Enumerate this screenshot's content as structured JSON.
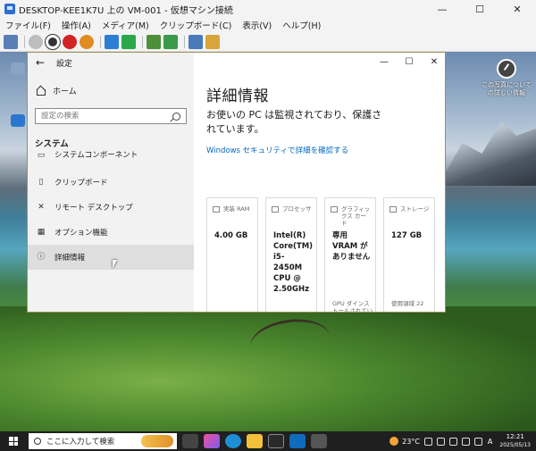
{
  "host": {
    "title": "DESKTOP-KEE1K7U 上の VM-001 - 仮想マシン接続",
    "controls": {
      "minimize": "—",
      "maximize": "☐",
      "close": "✕"
    },
    "menu": [
      "ファイル(F)",
      "操作(A)",
      "メディア(M)",
      "クリップボード(C)",
      "表示(V)",
      "ヘルプ(H)"
    ]
  },
  "desktop": {
    "shortcut_label": "この写真についての詳しい情報"
  },
  "settings": {
    "window_title": "設定",
    "back_glyph": "←",
    "controls": {
      "minimize": "—",
      "maximize": "☐",
      "close": "✕"
    },
    "home_label": "ホーム",
    "search_placeholder": "設定の検索",
    "section_heading": "システム",
    "nav_items": [
      {
        "label": "システムコンポーネント",
        "icon": "component-icon"
      },
      {
        "label": "クリップボード",
        "icon": "clipboard-icon"
      },
      {
        "label": "リモート デスクトップ",
        "icon": "remote-desktop-icon"
      },
      {
        "label": "オプション機能",
        "icon": "optional-features-icon"
      },
      {
        "label": "詳細情報",
        "icon": "info-icon"
      }
    ],
    "page_title": "詳細情報",
    "protection_text": "お使いの PC は監視されており、保護されています。",
    "security_link": "Windows セキュリティで詳細を確認する",
    "cards": [
      {
        "name": "実装 RAM",
        "value": "4.00 GB",
        "foot": ""
      },
      {
        "name": "プロセッサ",
        "value": "Intel(R) Core(TM) i5-2450M CPU @ 2.50GHz",
        "foot": ""
      },
      {
        "name": "グラフィックス カード",
        "value": "専用 VRAM がありません",
        "foot": "GPU ダインス トールされてい"
      },
      {
        "name": "ストレージ",
        "value": "127 GB",
        "foot": "使用領域 22"
      }
    ]
  },
  "taskbar": {
    "search_text": "ここに入力して検索",
    "temperature": "23°C",
    "ime": "A",
    "time": "12:21",
    "date": "2025/05/13"
  }
}
